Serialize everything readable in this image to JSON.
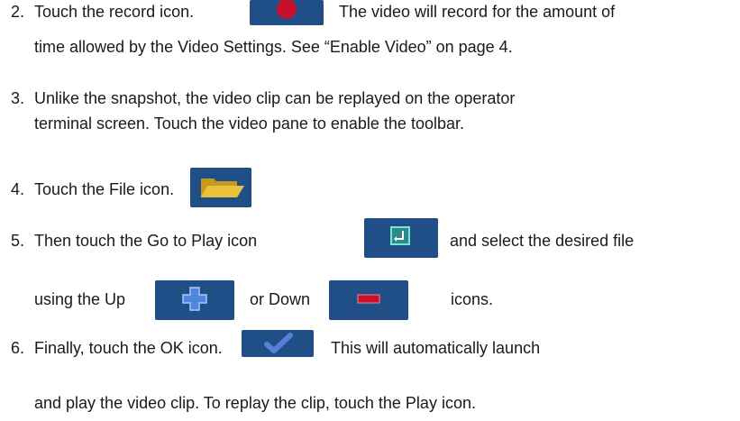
{
  "steps": {
    "s2": {
      "num": "2.",
      "text_a": "Touch the record icon.",
      "text_b": "The video will record for the amount of",
      "line2": "time allowed by the Video Settings. See “Enable Video” on page 4."
    },
    "s3": {
      "num": "3.",
      "line1": "Unlike the snapshot, the video clip can be replayed on the operator",
      "line2": "terminal screen. Touch the video pane to enable the toolbar."
    },
    "s4": {
      "num": "4.",
      "text": "Touch the File icon."
    },
    "s5": {
      "num": "5.",
      "text_a": "Then touch the Go to Play icon",
      "text_b": "and select the desired file",
      "line2_a": "using the Up",
      "line2_b": "or Down",
      "line2_c": "icons."
    },
    "s6": {
      "num": "6.",
      "text_a": "Finally, touch the OK icon.",
      "text_b": "This will automatically launch",
      "line2": "and play the video clip. To replay the clip, touch the Play icon."
    }
  },
  "icons": {
    "record": "record-icon",
    "file": "folder-icon",
    "go_to_play": "go-to-play-icon",
    "up": "plus-icon",
    "down": "minus-icon",
    "ok": "checkmark-icon"
  },
  "colors": {
    "icon_bg": "#1f4f86",
    "record_red": "#c8102e",
    "folder_yellow": "#e9c23a",
    "check_blue": "#5b7fd6"
  }
}
